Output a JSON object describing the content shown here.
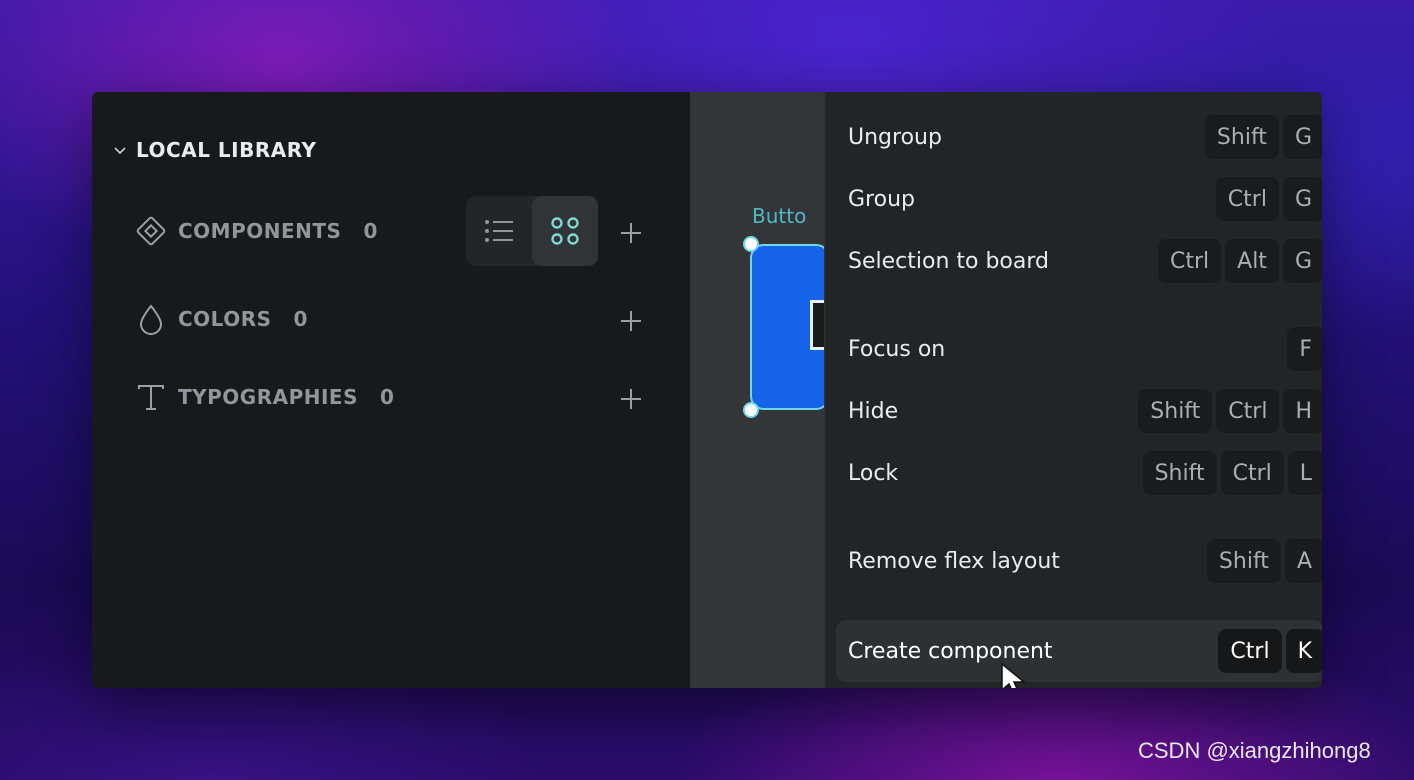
{
  "library": {
    "title": "LOCAL LIBRARY",
    "sections": [
      {
        "label": "COMPONENTS",
        "count": "0",
        "icon": "component-diamond-icon"
      },
      {
        "label": "COLORS",
        "count": "0",
        "icon": "color-drop-icon"
      },
      {
        "label": "TYPOGRAPHIES",
        "count": "0",
        "icon": "typography-t-icon"
      }
    ]
  },
  "canvas": {
    "board_label": "Butto",
    "board_color": "#1463e8",
    "selection_color": "#6ed8ea"
  },
  "menu": {
    "items": [
      {
        "label": "Ungroup",
        "keys": [
          "Shift",
          "G"
        ]
      },
      {
        "label": "Group",
        "keys": [
          "Ctrl",
          "G"
        ]
      },
      {
        "label": "Selection to board",
        "keys": [
          "Ctrl",
          "Alt",
          "G"
        ]
      },
      {
        "label": "Focus on",
        "keys": [
          "F"
        ]
      },
      {
        "label": "Hide",
        "keys": [
          "Shift",
          "Ctrl",
          "H"
        ]
      },
      {
        "label": "Lock",
        "keys": [
          "Shift",
          "Ctrl",
          "L"
        ]
      },
      {
        "label": "Remove flex layout",
        "keys": [
          "Shift",
          "A"
        ]
      },
      {
        "label": "Create component",
        "keys": [
          "Ctrl",
          "K"
        ],
        "highlighted": true
      }
    ]
  },
  "watermark": "CSDN @xiangzhihong8",
  "colors": {
    "accent_teal": "#7fd6d0",
    "panel_bg": "#18191b",
    "menu_bg": "#222526"
  }
}
